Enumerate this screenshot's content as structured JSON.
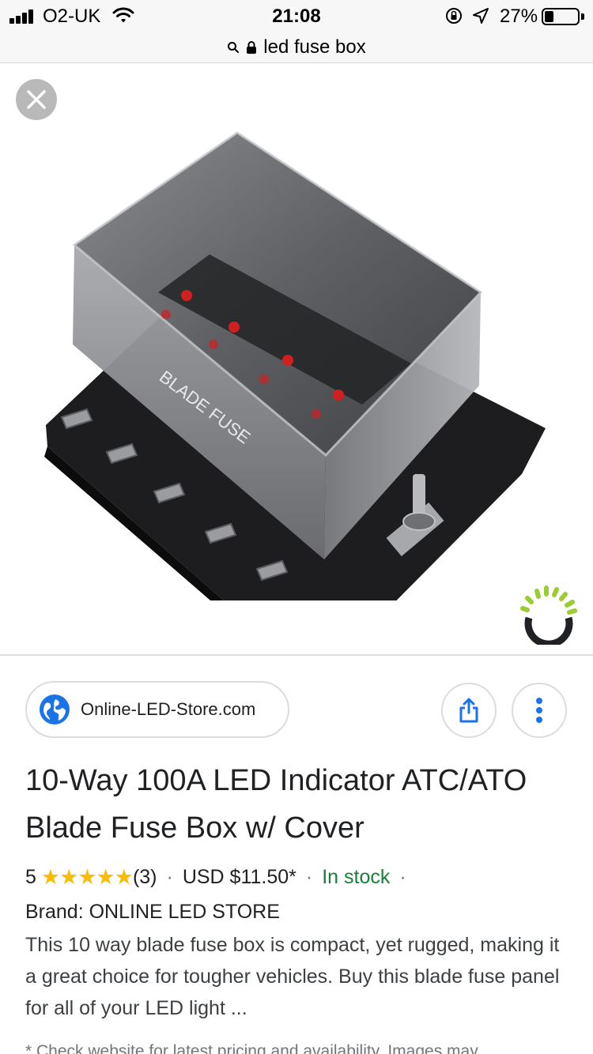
{
  "status_bar": {
    "carrier": "O2-UK",
    "time": "21:08",
    "battery_percent": "27%",
    "battery_level": 0.27,
    "signal_bars": 4
  },
  "url_bar": {
    "query": "led fuse box",
    "icons": [
      "search-icon",
      "lock-icon"
    ]
  },
  "viewer": {
    "close_icon": "close-icon",
    "image_lettering": "BLADE FUSE",
    "loading_icon": "loading-spinner-icon",
    "loader_colors": [
      "#9acd32",
      "#202124"
    ]
  },
  "result": {
    "source": "Online-LED-Store.com",
    "title": "10-Way 100A LED Indicator ATC/ATO Blade Fuse Box w/ Cover",
    "rating_value": "5",
    "stars": "★★★★★",
    "review_count": "(3)",
    "separator": "·",
    "price": "USD $11.50*",
    "stock": "In stock",
    "brand": "Brand: ONLINE LED STORE",
    "description": "This 10 way blade fuse box is compact, yet rugged, making it a great choice for tougher vehicles. Buy this blade fuse panel for all of your LED light ...",
    "footnote": "* Check website for latest pricing and availability. Images may"
  },
  "colors": {
    "star": "#fbbc04",
    "in_stock": "#188038",
    "link_blue": "#1a73e8",
    "chip_border": "#dadce0"
  }
}
